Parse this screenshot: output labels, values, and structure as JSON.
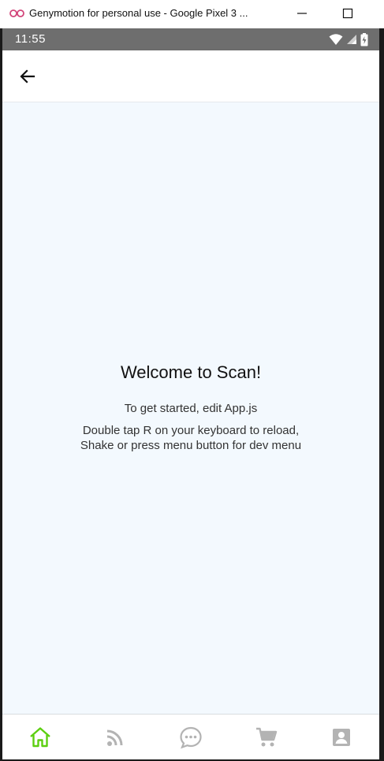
{
  "window": {
    "title": "Genymotion for personal use - Google Pixel 3 ...",
    "logo_icon": "genymotion-logo-icon",
    "minimize_icon": "minimize-icon",
    "maximize_icon": "maximize-icon"
  },
  "status_bar": {
    "time": "11:55",
    "icons": [
      "wifi-icon",
      "signal-icon",
      "battery-icon"
    ]
  },
  "app_bar": {
    "back_icon": "arrow-left-icon"
  },
  "main": {
    "welcome": "Welcome to Scan!",
    "instructions": "To get started, edit App.js",
    "dev_hint_line1": "Double tap R on your keyboard to reload,",
    "dev_hint_line2": "Shake or press menu button for dev menu"
  },
  "tab_bar": {
    "tabs": [
      {
        "icon": "home-icon",
        "active": true
      },
      {
        "icon": "feed-icon",
        "active": false
      },
      {
        "icon": "chat-icon",
        "active": false
      },
      {
        "icon": "cart-icon",
        "active": false
      },
      {
        "icon": "profile-icon",
        "active": false
      }
    ]
  },
  "colors": {
    "accent_active": "#5ccf10",
    "icon_inactive": "#b3b3b3",
    "status_bar": "#6e6e6e",
    "content_bg": "#f3f9fe"
  }
}
